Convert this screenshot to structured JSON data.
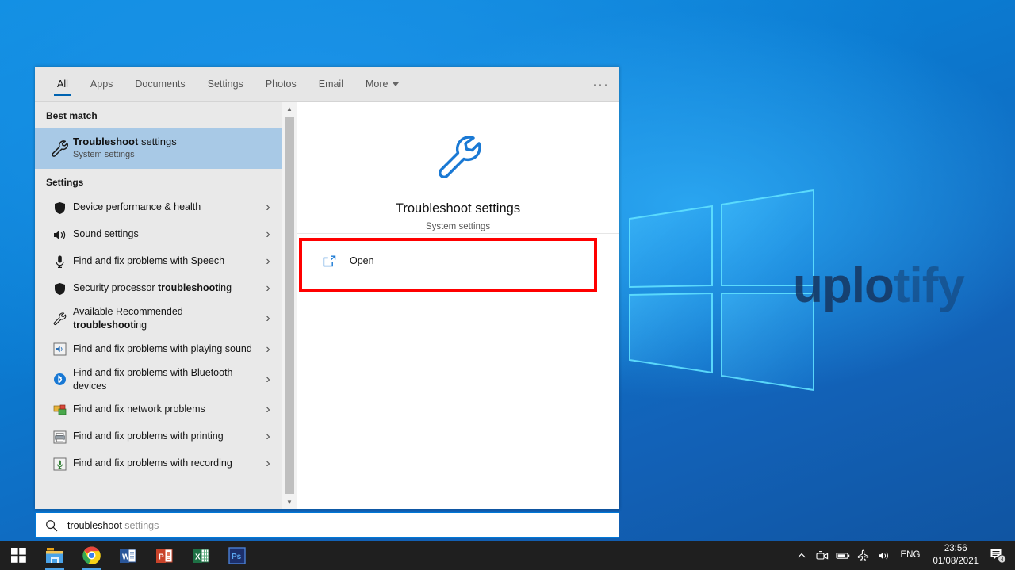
{
  "desktop": {
    "watermark_main": "uplo",
    "watermark_fade": "tify",
    "logo_name": "windows-logo"
  },
  "search_panel": {
    "tabs": [
      {
        "label": "All",
        "active": true
      },
      {
        "label": "Apps",
        "active": false
      },
      {
        "label": "Documents",
        "active": false
      },
      {
        "label": "Settings",
        "active": false
      },
      {
        "label": "Photos",
        "active": false
      },
      {
        "label": "Email",
        "active": false
      },
      {
        "label": "More",
        "active": false,
        "has_caret": true
      }
    ],
    "overflow_label": "···",
    "best_match": {
      "header": "Best match",
      "title_bold": "Troubleshoot",
      "title_rest": " settings",
      "subtitle": "System settings",
      "icon": "wrench-icon"
    },
    "settings_section": {
      "header": "Settings",
      "items": [
        {
          "label_pre": "Device performance & health",
          "label_bold": "",
          "label_post": "",
          "icon": "shield-icon",
          "chevron": "›"
        },
        {
          "label_pre": "Sound settings",
          "label_bold": "",
          "label_post": "",
          "icon": "speaker-icon",
          "chevron": "›"
        },
        {
          "label_pre": "Find and fix problems with Speech",
          "label_bold": "",
          "label_post": "",
          "icon": "microphone-icon",
          "chevron": "›"
        },
        {
          "label_pre": "Security processor ",
          "label_bold": "troubleshoot",
          "label_post": "ing",
          "icon": "shield-icon",
          "chevron": "›"
        },
        {
          "label_pre": "Available Recommended ",
          "label_bold": "troubleshoot",
          "label_post": "ing",
          "icon": "wrench-thin-icon",
          "chevron": "›"
        },
        {
          "label_pre": "Find and fix problems with playing sound",
          "label_bold": "",
          "label_post": "",
          "icon": "sound-tile-icon",
          "chevron": "›"
        },
        {
          "label_pre": "Find and fix problems with Bluetooth devices",
          "label_bold": "",
          "label_post": "",
          "icon": "bluetooth-icon",
          "chevron": "›"
        },
        {
          "label_pre": "Find and fix network problems",
          "label_bold": "",
          "label_post": "",
          "icon": "network-icon",
          "chevron": "›"
        },
        {
          "label_pre": "Find and fix problems with printing",
          "label_bold": "",
          "label_post": "",
          "icon": "printer-icon",
          "chevron": "›"
        },
        {
          "label_pre": "Find and fix problems with recording",
          "label_bold": "",
          "label_post": "",
          "icon": "recording-icon",
          "chevron": "›"
        }
      ]
    },
    "preview": {
      "title": "Troubleshoot settings",
      "subtitle": "System settings",
      "icon": "wrench-large-icon",
      "open_label": "Open",
      "open_icon": "open-external-icon"
    },
    "annotation": {
      "color": "#ff0000",
      "shape": "rectangle",
      "target": "open-row"
    }
  },
  "search_input": {
    "typed_text": "troubleshoot",
    "suggestion_text": " settings",
    "icon": "search-icon"
  },
  "taskbar": {
    "apps": [
      {
        "name": "start-button",
        "icon": "windows-start-icon",
        "running": false
      },
      {
        "name": "file-explorer",
        "icon": "folder-icon",
        "running": true
      },
      {
        "name": "google-chrome",
        "icon": "chrome-icon",
        "running": true
      },
      {
        "name": "microsoft-word",
        "icon": "word-icon",
        "running": false
      },
      {
        "name": "microsoft-powerpoint",
        "icon": "powerpoint-icon",
        "running": false
      },
      {
        "name": "microsoft-excel",
        "icon": "excel-icon",
        "running": false
      },
      {
        "name": "adobe-photoshop",
        "icon": "photoshop-icon",
        "running": false
      }
    ],
    "tray": {
      "chevron": "∧",
      "icons": [
        "camera-icon",
        "battery-icon",
        "airplane-mode-icon",
        "volume-icon"
      ],
      "language": "ENG",
      "time": "23:56",
      "date": "01/08/2021",
      "notification_icon": "notification-icon",
      "notification_count": "4"
    }
  }
}
